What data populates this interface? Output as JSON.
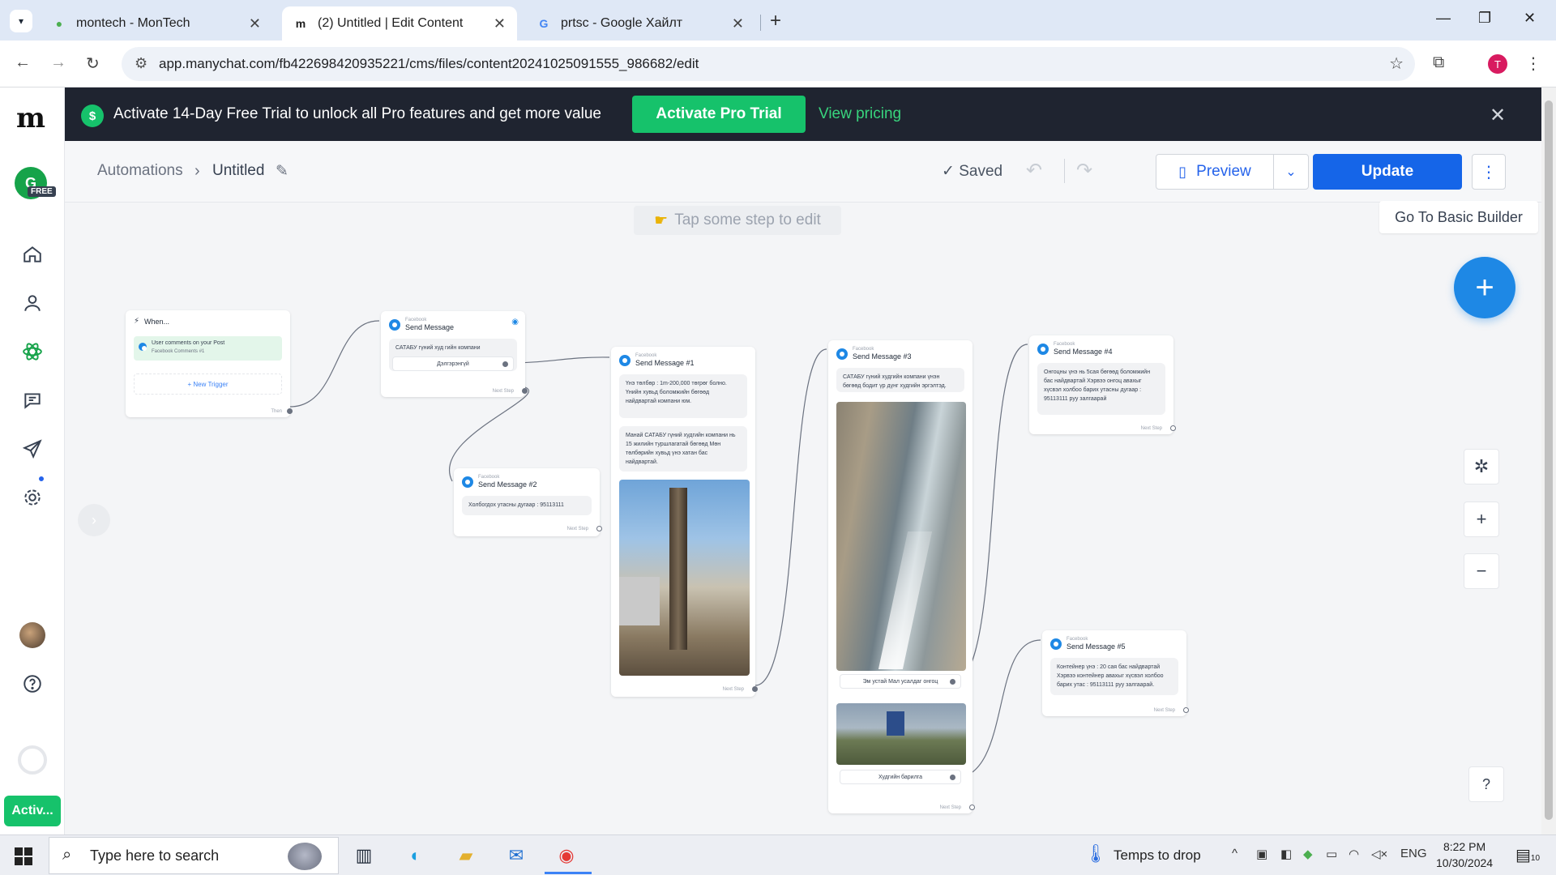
{
  "browser": {
    "tabs": [
      {
        "title": "montech - MonTech",
        "favicon": "green-favicon"
      },
      {
        "title": "(2) Untitled | Edit Content",
        "favicon": "manychat-favicon"
      },
      {
        "title": "prtsc - Google Хайлт",
        "favicon": "google-favicon"
      }
    ],
    "url": "app.manychat.com/fb422698420935221/cms/files/content20241025091555_986682/edit",
    "profile_initial": "T"
  },
  "sidebar": {
    "workspace_initial": "G",
    "free_badge": "FREE",
    "activate_label": "Activ..."
  },
  "banner": {
    "message": "Activate 14-Day Free Trial to unlock all Pro features and get more value",
    "trial_button": "Activate Pro Trial",
    "pricing_link": "View pricing",
    "dollar": "$"
  },
  "header": {
    "crumb_root": "Automations",
    "crumb_current": "Untitled",
    "saved": "✓ Saved",
    "preview": "Preview",
    "update": "Update"
  },
  "canvas": {
    "tap_hint": "Tap some step to edit",
    "basic_builder": "Go To Basic Builder"
  },
  "flow": {
    "platform": "Facebook",
    "next_step": "Next Step",
    "trigger": {
      "title": "When...",
      "item_title": "User comments on your Post",
      "item_sub": "Facebook Comments #1",
      "new_trigger": "+ New Trigger",
      "then": "Then"
    },
    "msg0": {
      "title": "Send Message",
      "text": "САТАБУ гүний худ гийн компани",
      "button": "Дэлгэрэнгүй"
    },
    "msg1": {
      "title": "Send Message #1",
      "text1": "Үнэ төлбөр : 1m-200,000 төгрөг болно. Үнийн хувьд боломжийн бөгөөд найдвартай компани юм.",
      "text2": "Манай САТАБУ гүний худгийн компани нь 15 жилийн туршлагатай бөгөөд Мөн төлбөрийн хувьд үнэ хатан бас найдвартай."
    },
    "msg2": {
      "title": "Send Message #2",
      "text": "Холбогдох утасны дугаар : 95113111"
    },
    "msg3": {
      "title": "Send Message #3",
      "text": "САТАБУ гүний худгийн компани үнэн бөгөөд бодит үр дүнг худгийн эргэлтэд.",
      "button1": "Эм устай Мал усалдаг онгоц",
      "button2": "Худгийн барилга"
    },
    "msg4": {
      "title": "Send Message #4",
      "text": "Онгоцны үнэ нь 5сая бөгөөд боломжийн бас найдвартай Хэрвээ онгоц авахыг хүсвэл холбоо барих утасны дугаар : 95113111 руу залгаарай"
    },
    "msg5": {
      "title": "Send Message #5",
      "text": "Контейнер үнэ : 20 сая бас найдвартай Хэрвээ контейнер авахыг хүсвэл холбоо барих утас : 95113111 руу залгаарай."
    }
  },
  "taskbar": {
    "search_placeholder": "Type here to search",
    "weather": "Temps to drop",
    "lang": "ENG",
    "time": "8:22 PM",
    "date": "10/30/2024",
    "notif_count": "10"
  }
}
